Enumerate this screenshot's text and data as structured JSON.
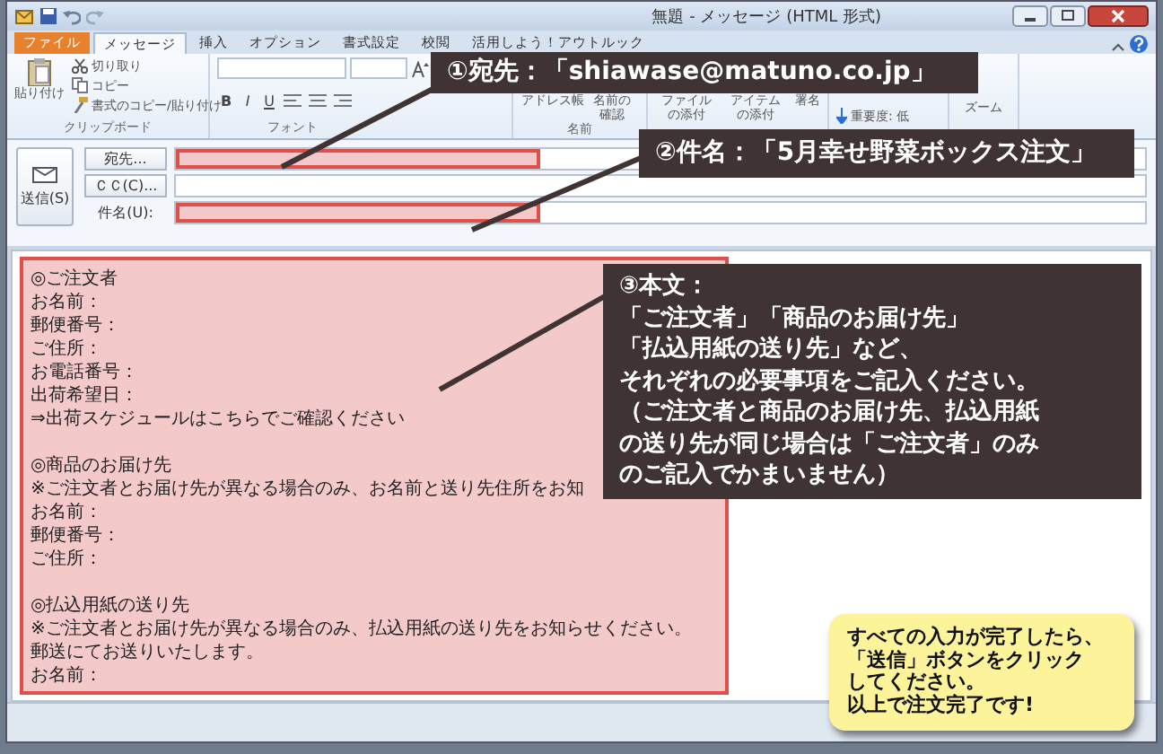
{
  "window": {
    "title": "無題 - メッセージ (HTML 形式)"
  },
  "tabs": [
    {
      "label": "ファイル",
      "kind": "file",
      "selected": false
    },
    {
      "label": "メッセージ",
      "kind": "tab",
      "selected": true
    },
    {
      "label": "挿入",
      "kind": "tab",
      "selected": false
    },
    {
      "label": "オプション",
      "kind": "tab",
      "selected": false
    },
    {
      "label": "書式設定",
      "kind": "tab",
      "selected": false
    },
    {
      "label": "校閲",
      "kind": "tab",
      "selected": false
    },
    {
      "label": "活用しよう！アウトルック",
      "kind": "tab",
      "selected": false
    }
  ],
  "ribbon": {
    "clipboard": {
      "paste": "貼り付け",
      "cut": "切り取り",
      "copy": "コピー",
      "format_painter": "書式のコピー/貼り付け",
      "group": "クリップボード"
    },
    "font": {
      "format_buttons": [
        "B",
        "I",
        "U"
      ],
      "group": "フォント"
    },
    "names": {
      "buttons": [
        "アドレス帳",
        "名前の確認"
      ],
      "group": "名前"
    },
    "include": {
      "buttons": [
        "ファイルの添付",
        "アイテムの添付",
        "署名"
      ]
    },
    "tags": {
      "importance_low": "重要度: 低"
    },
    "zoom": {
      "label": "ズーム"
    }
  },
  "header": {
    "send_button": "送信(S)",
    "to": {
      "button": "宛先...",
      "highlighted": true
    },
    "cc": {
      "button": "ＣＣ(C)...",
      "highlighted": false
    },
    "subject": {
      "label": "件名(U):",
      "highlighted": true
    }
  },
  "body": {
    "highlighted": true,
    "paragraphs": [
      [
        "◎ご注文者",
        "お名前：",
        "郵便番号：",
        "ご住所：",
        "お電話番号：",
        "出荷希望日：",
        "⇒出荷スケジュールはこちらでご確認ください"
      ],
      [
        "◎商品のお届け先",
        "※ご注文者とお届け先が異なる場合のみ、お名前と送り先住所をお知",
        "お名前：",
        "郵便番号：",
        "ご住所："
      ],
      [
        "◎払込用紙の送り先",
        "※ご注文者とお届け先が異なる場合のみ、払込用紙の送り先をお知らせください。",
        "郵送にてお送りいたします。",
        "お名前："
      ]
    ]
  },
  "annotations": [
    {
      "kind": "dark",
      "lines": [
        "①宛先：「shiawase@matuno.co.jp」"
      ]
    },
    {
      "kind": "dark",
      "lines": [
        "②件名：「5月幸せ野菜ボックス注文」"
      ]
    },
    {
      "kind": "dark",
      "lines": [
        "③本文：",
        "「ご注文者」「商品のお届け先」",
        "「払込用紙の送り先」など、",
        "それぞれの必要事項をご記入ください。",
        "（ご注文者と商品のお届け先、払込用紙",
        "の送り先が同じ場合は「ご注文者」のみ",
        "のご記入でかまいません）"
      ]
    },
    {
      "kind": "note",
      "lines": [
        "すべての入力が完了したら、",
        "「送信」ボタンをクリック",
        "してください。",
        "以上で注文完了です!"
      ]
    }
  ]
}
